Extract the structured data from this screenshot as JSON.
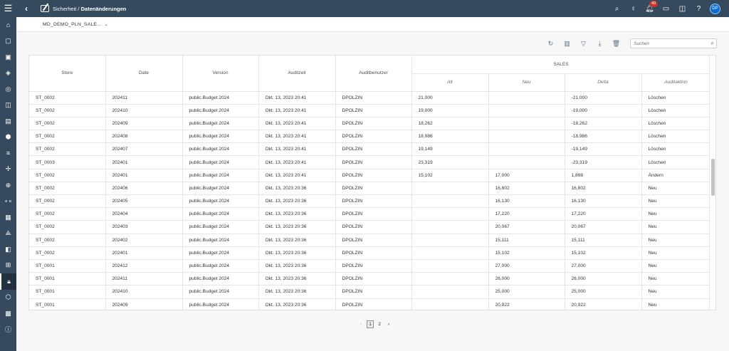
{
  "header": {
    "menu_icon": "hamburger-icon",
    "back_icon": "chevron-left-icon",
    "breadcrumb_prefix": "Sicherheit / ",
    "breadcrumb_title": "Datenänderungen",
    "notification_count": "49",
    "avatar_initials": "DP"
  },
  "subheader": {
    "model_name": "MD_DEMO_PLN_SALE..."
  },
  "toolbar": {
    "search_placeholder": "Suchen"
  },
  "table": {
    "columns": [
      "Store",
      "Date",
      "Version",
      "Auditzeit",
      "Auditbenutzer"
    ],
    "group_header": "SALES",
    "sub_columns": [
      "Alt",
      "Neu",
      "Delta",
      "Auditaktion"
    ],
    "rows": [
      [
        "ST_0002",
        "202411",
        "public.Budget 2024",
        "Okt. 13, 2023 20:41",
        "DPOLZIN",
        "21,000",
        "",
        "-21,000",
        "Löschen"
      ],
      [
        "ST_0002",
        "202410",
        "public.Budget 2024",
        "Okt. 13, 2023 20:41",
        "DPOLZIN",
        "19,000",
        "",
        "-19,000",
        "Löschen"
      ],
      [
        "ST_0002",
        "202409",
        "public.Budget 2024",
        "Okt. 13, 2023 20:41",
        "DPOLZIN",
        "18,262",
        "",
        "-18,262",
        "Löschen"
      ],
      [
        "ST_0002",
        "202408",
        "public.Budget 2024",
        "Okt. 13, 2023 20:41",
        "DPOLZIN",
        "18,986",
        "",
        "-18,986",
        "Löschen"
      ],
      [
        "ST_0002",
        "202407",
        "public.Budget 2024",
        "Okt. 13, 2023 20:41",
        "DPOLZIN",
        "19,149",
        "",
        "-19,149",
        "Löschen"
      ],
      [
        "ST_0003",
        "202401",
        "public.Budget 2024",
        "Okt. 13, 2023 20:41",
        "DPOLZIN",
        "23,319",
        "",
        "-23,319",
        "Löschen"
      ],
      [
        "ST_0002",
        "202401",
        "public.Budget 2024",
        "Okt. 13, 2023 20:41",
        "DPOLZIN",
        "15,102",
        "17,000",
        "1,898",
        "Ändern"
      ],
      [
        "ST_0002",
        "202406",
        "public.Budget 2024",
        "Okt. 13, 2023 20:36",
        "DPOLZIN",
        "",
        "16,802",
        "16,802",
        "Neu"
      ],
      [
        "ST_0002",
        "202405",
        "public.Budget 2024",
        "Okt. 13, 2023 20:36",
        "DPOLZIN",
        "",
        "16,130",
        "16,130",
        "Neu"
      ],
      [
        "ST_0002",
        "202404",
        "public.Budget 2024",
        "Okt. 13, 2023 20:36",
        "DPOLZIN",
        "",
        "17,220",
        "17,220",
        "Neu"
      ],
      [
        "ST_0002",
        "202403",
        "public.Budget 2024",
        "Okt. 13, 2023 20:36",
        "DPOLZIN",
        "",
        "20,067",
        "20,067",
        "Neu"
      ],
      [
        "ST_0002",
        "202402",
        "public.Budget 2024",
        "Okt. 13, 2023 20:36",
        "DPOLZIN",
        "",
        "15,111",
        "15,111",
        "Neu"
      ],
      [
        "ST_0002",
        "202401",
        "public.Budget 2024",
        "Okt. 13, 2023 20:36",
        "DPOLZIN",
        "",
        "15,102",
        "15,102",
        "Neu"
      ],
      [
        "ST_0001",
        "202412",
        "public.Budget 2024",
        "Okt. 13, 2023 20:36",
        "DPOLZIN",
        "",
        "27,000",
        "27,000",
        "Neu"
      ],
      [
        "ST_0001",
        "202411",
        "public.Budget 2024",
        "Okt. 13, 2023 20:36",
        "DPOLZIN",
        "",
        "26,000",
        "26,000",
        "Neu"
      ],
      [
        "ST_0001",
        "202410",
        "public.Budget 2024",
        "Okt. 13, 2023 20:36",
        "DPOLZIN",
        "",
        "25,000",
        "25,000",
        "Neu"
      ],
      [
        "ST_0001",
        "202409",
        "public.Budget 2024",
        "Okt. 13, 2023 20:36",
        "DPOLZIN",
        "",
        "20,922",
        "20,922",
        "Neu"
      ]
    ]
  },
  "pager": {
    "pages": [
      "1",
      "2"
    ],
    "current": "1"
  }
}
